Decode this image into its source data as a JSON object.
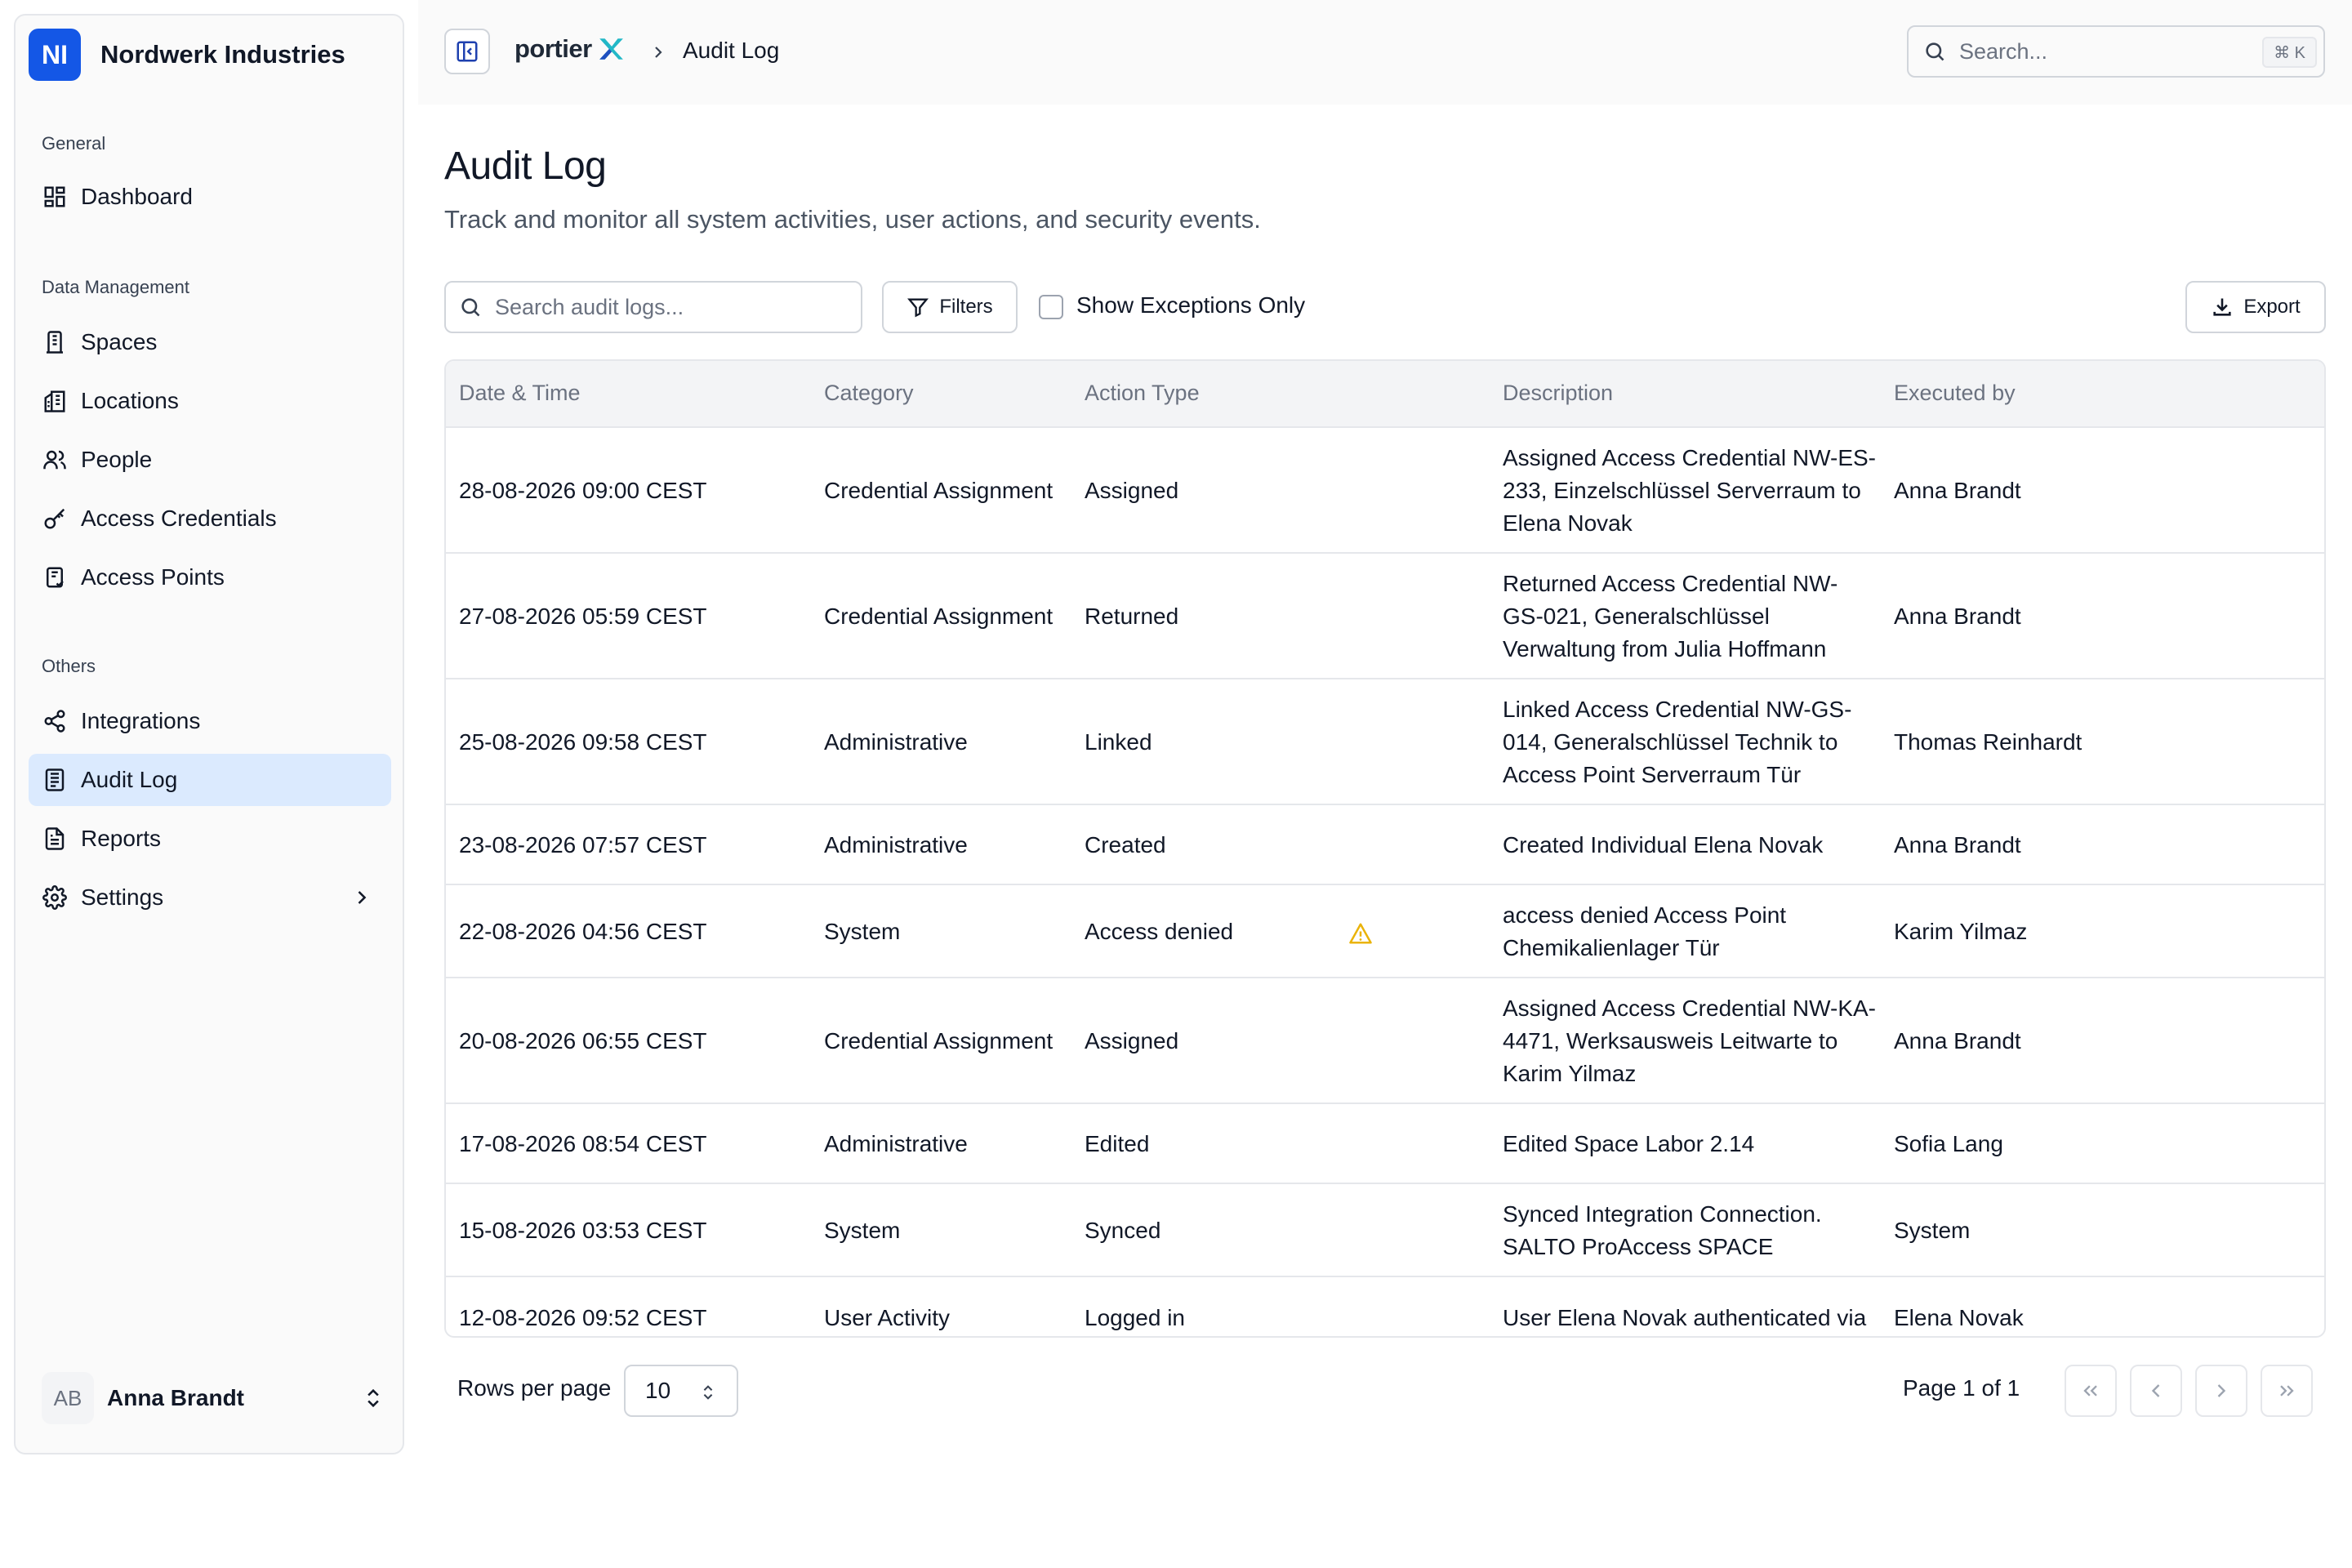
{
  "org": {
    "initials": "NI",
    "name": "Nordwerk Industries"
  },
  "sidebar": {
    "sections": [
      {
        "label": "General",
        "items": [
          {
            "label": "Dashboard",
            "icon": "dashboard-icon"
          }
        ]
      },
      {
        "label": "Data Management",
        "items": [
          {
            "label": "Spaces",
            "icon": "building-icon"
          },
          {
            "label": "Locations",
            "icon": "buildings-icon"
          },
          {
            "label": "People",
            "icon": "users-icon"
          },
          {
            "label": "Access Credentials",
            "icon": "key-icon"
          },
          {
            "label": "Access Points",
            "icon": "door-icon"
          }
        ]
      },
      {
        "label": "Others",
        "items": [
          {
            "label": "Integrations",
            "icon": "share-icon"
          },
          {
            "label": "Audit Log",
            "icon": "log-icon",
            "active": true
          },
          {
            "label": "Reports",
            "icon": "report-icon"
          },
          {
            "label": "Settings",
            "icon": "gear-icon"
          }
        ]
      }
    ],
    "user": {
      "initials": "AB",
      "name": "Anna Brandt"
    }
  },
  "topbar": {
    "brand": "portier",
    "breadcrumb_current": "Audit Log",
    "search_placeholder": "Search...",
    "shortcut": "⌘ K"
  },
  "page": {
    "title": "Audit Log",
    "subtitle": "Track and monitor all system activities, user actions, and security events."
  },
  "toolbar": {
    "search_placeholder": "Search audit logs...",
    "filters_label": "Filters",
    "exceptions_label": "Show Exceptions Only",
    "exceptions_checked": false,
    "export_label": "Export"
  },
  "table": {
    "columns": [
      "Date & Time",
      "Category",
      "Action Type",
      "Description",
      "Executed by"
    ],
    "rows": [
      {
        "date": "28-08-2026 09:00 CEST",
        "category": "Credential Assignment",
        "action": "Assigned",
        "warning": false,
        "description": "Assigned Access Credential NW-ES-233, Einzelschlüssel Serverraum to Elena Novak",
        "executed_by": "Anna Brandt"
      },
      {
        "date": "27-08-2026 05:59 CEST",
        "category": "Credential Assignment",
        "action": "Returned",
        "warning": false,
        "description": "Returned Access Credential NW-GS-021, Generalschlüssel Verwaltung from Julia Hoffmann",
        "executed_by": "Anna Brandt"
      },
      {
        "date": "25-08-2026 09:58 CEST",
        "category": "Administrative",
        "action": "Linked",
        "warning": false,
        "description": "Linked Access Credential NW-GS-014, Generalschlüssel Technik to Access Point Serverraum Tür",
        "executed_by": "Thomas Reinhardt"
      },
      {
        "date": "23-08-2026 07:57 CEST",
        "category": "Administrative",
        "action": "Created",
        "warning": false,
        "description": "Created Individual Elena Novak",
        "executed_by": "Anna Brandt"
      },
      {
        "date": "22-08-2026 04:56 CEST",
        "category": "System",
        "action": "Access denied",
        "warning": true,
        "description": "access denied Access Point Chemikalienlager Tür",
        "executed_by": "Karim Yilmaz"
      },
      {
        "date": "20-08-2026 06:55 CEST",
        "category": "Credential Assignment",
        "action": "Assigned",
        "warning": false,
        "description": "Assigned Access Credential NW-KA-4471, Werksausweis Leitwarte to Karim Yilmaz",
        "executed_by": "Anna Brandt"
      },
      {
        "date": "17-08-2026 08:54 CEST",
        "category": "Administrative",
        "action": "Edited",
        "warning": false,
        "description": "Edited Space Labor 2.14",
        "executed_by": "Sofia Lang"
      },
      {
        "date": "15-08-2026 03:53 CEST",
        "category": "System",
        "action": "Synced",
        "warning": false,
        "description": "Synced Integration Connection. SALTO ProAccess SPACE",
        "executed_by": "System"
      },
      {
        "date": "12-08-2026 09:52 CEST",
        "category": "User Activity",
        "action": "Logged in",
        "warning": false,
        "description": "User Elena Novak authenticated via",
        "executed_by": "Elena Novak"
      }
    ]
  },
  "pagination": {
    "rows_per_page_label": "Rows per page",
    "rows_per_page_value": "10",
    "page_info": "Page 1 of 1"
  },
  "colors": {
    "accent": "#1457e6",
    "active_bg": "#dbeafe",
    "warning": "#eab308",
    "brand_teal": "#22b8c7"
  }
}
